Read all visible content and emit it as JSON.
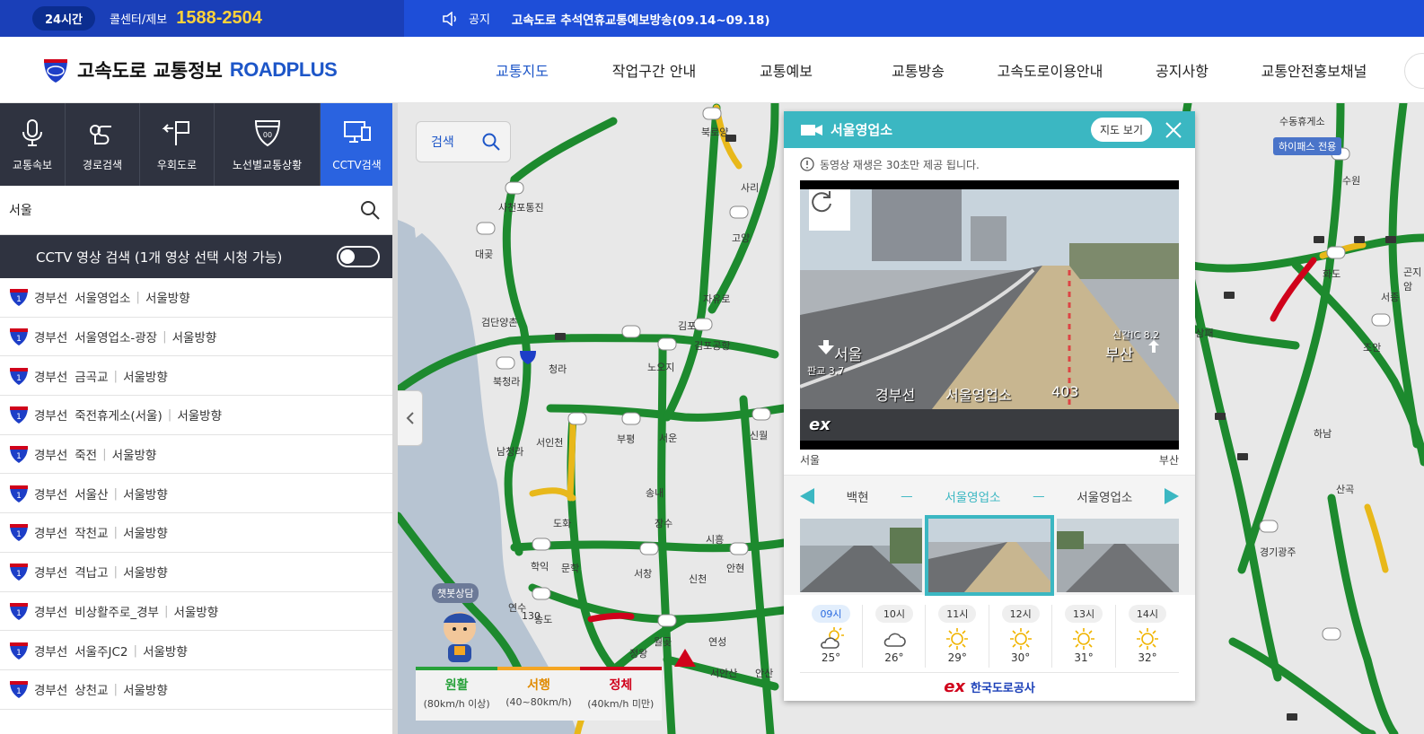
{
  "topbar": {
    "hours_badge": "24시간",
    "callcenter_label": "콜센터/제보",
    "phone": "1588-2504",
    "notice_label": "공지",
    "notice_title": "고속도로 추석연휴교통예보방송(09.14~09.18)"
  },
  "header": {
    "logo_kr": "고속도로 교통정보",
    "logo_en": "ROADPLUS",
    "nav": [
      "교통지도",
      "작업구간 안내",
      "교통예보",
      "교통방송",
      "고속도로이용안내",
      "공지사항",
      "교통안전홍보채널"
    ],
    "active_nav": 0
  },
  "sidebar": {
    "menu": [
      "교통속보",
      "경로검색",
      "우회도로",
      "노선별교통상황",
      "CCTV검색"
    ],
    "menu_icons": [
      "microphone-icon",
      "route-icon",
      "detour-icon",
      "route-shield-icon",
      "monitor-icon"
    ],
    "active_menu": 4,
    "search_value": "서울",
    "cctv_bar_label": "CCTV 영상 검색 (1개 영상 선택 시청 가능)",
    "results": [
      {
        "road": "경부선",
        "name": "서울영업소",
        "dir": "서울방향"
      },
      {
        "road": "경부선",
        "name": "서울영업소-광장",
        "dir": "서울방향"
      },
      {
        "road": "경부선",
        "name": "금곡교",
        "dir": "서울방향"
      },
      {
        "road": "경부선",
        "name": "죽전휴게소(서울)",
        "dir": "서울방향"
      },
      {
        "road": "경부선",
        "name": "죽전",
        "dir": "서울방향"
      },
      {
        "road": "경부선",
        "name": "서울산",
        "dir": "서울방향"
      },
      {
        "road": "경부선",
        "name": "작천교",
        "dir": "서울방향"
      },
      {
        "road": "경부선",
        "name": "격납고",
        "dir": "서울방향"
      },
      {
        "road": "경부선",
        "name": "비상활주로_경부",
        "dir": "서울방향"
      },
      {
        "road": "경부선",
        "name": "서울주JC2",
        "dir": "서울방향"
      },
      {
        "road": "경부선",
        "name": "상천교",
        "dir": "서울방향"
      }
    ],
    "route_number": "1"
  },
  "map": {
    "search_label": "검색",
    "chatbot_label": "챗봇상담",
    "hipass_label": "하이패스 전용",
    "legend": [
      {
        "name": "원활",
        "range": "(80km/h 이상)"
      },
      {
        "name": "서행",
        "range": "(40~80km/h)"
      },
      {
        "name": "정체",
        "range": "(40km/h 미만)"
      }
    ],
    "labels": [
      "사천포통진",
      "대곶",
      "검단양촌",
      "북청라",
      "청라",
      "노오지",
      "김포공항",
      "김포",
      "서운",
      "부평",
      "서인천",
      "남청라",
      "도화",
      "장수",
      "송내",
      "시흥",
      "안현",
      "신천",
      "학익",
      "문학",
      "서창",
      "연수",
      "송도",
      "월곶",
      "정왕",
      "연성",
      "서안산",
      "안산",
      "고양",
      "사리",
      "북로양",
      "자유로",
      "신월",
      "수원",
      "하남",
      "산곡",
      "경기광주",
      "조안",
      "화도",
      "곤지암",
      "서종",
      "덕소삼패",
      "수동휴게소"
    ],
    "route_130": "130"
  },
  "popup": {
    "title": "서울영업소",
    "map_view_btn": "지도 보기",
    "notice": "동영상 재생은 30초만 제공 됩니다.",
    "video": {
      "left_dir": "서울",
      "left_sub": "판교 3.7",
      "right_dir": "부산",
      "right_sub": "신갈IC 8.2",
      "caption_road": "경부선",
      "caption_site": "서울영업소",
      "caption_num": "403",
      "brand": "ex"
    },
    "dir_left": "서울",
    "dir_right": "부산",
    "prev_site": "백현",
    "current_site": "서울영업소",
    "next_site": "서울영업소",
    "weather": [
      {
        "time": "09시",
        "temp": "25°",
        "icon": "partly-cloudy-icon"
      },
      {
        "time": "10시",
        "temp": "26°",
        "icon": "cloud-icon"
      },
      {
        "time": "11시",
        "temp": "29°",
        "icon": "sun-icon"
      },
      {
        "time": "12시",
        "temp": "30°",
        "icon": "sun-icon"
      },
      {
        "time": "13시",
        "temp": "31°",
        "icon": "sun-icon"
      },
      {
        "time": "14시",
        "temp": "32°",
        "icon": "sun-icon"
      }
    ],
    "footer_brand": "한국도로공사",
    "footer_logo": "ex"
  },
  "colors": {
    "topbar_left": "#1a3fb8",
    "topbar_right": "#1e4ed8",
    "accent": "#3bb7c2",
    "road_green": "#1d8a2e",
    "road_yellow": "#e8b81a",
    "road_red": "#d0021b"
  }
}
